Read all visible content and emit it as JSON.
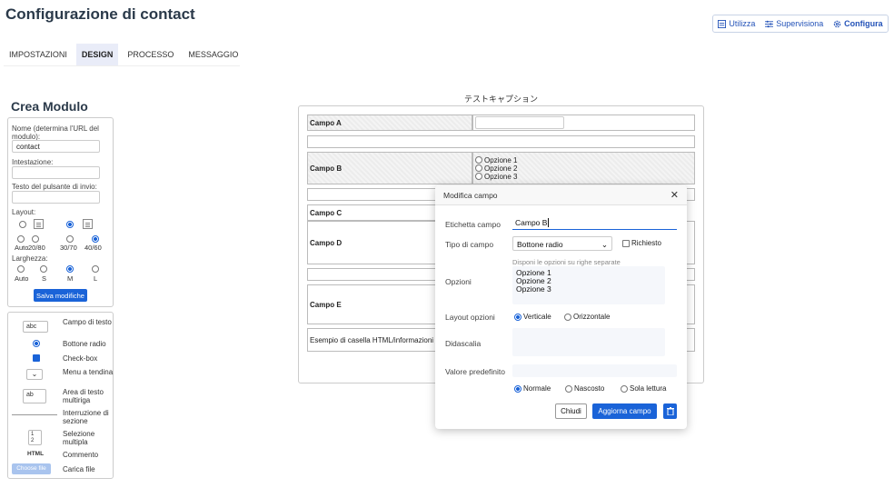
{
  "page_title": "Configurazione di contact",
  "top_actions": [
    {
      "label": "Utilizza",
      "icon": "chart-icon"
    },
    {
      "label": "Supervisiona",
      "icon": "sliders-icon"
    },
    {
      "label": "Configura",
      "icon": "gear-icon"
    }
  ],
  "tabs": [
    "IMPOSTAZIONI",
    "DESIGN",
    "PROCESSO",
    "MESSAGGIO"
  ],
  "active_tab": "DESIGN",
  "sidebar": {
    "heading": "Crea Modulo",
    "name_label": "Nome (determina l'URL del modulo):",
    "name_value": "contact",
    "intestazione_label": "Intestazione:",
    "submit_label": "Testo del pulsante di invio:",
    "layout_label": "Layout:",
    "layout_options": [
      "Auto",
      "20/80",
      "30/70",
      "40/60"
    ],
    "width_label": "Larghezza:",
    "width_options": [
      "Auto",
      "S",
      "M",
      "L"
    ],
    "save_button": "Salva modifiche"
  },
  "tools": [
    {
      "icon": "abc",
      "label": "Campo di testo"
    },
    {
      "icon": "radio",
      "label": "Bottone radio"
    },
    {
      "icon": "checkbox",
      "label": "Check-box"
    },
    {
      "icon": "dropdown",
      "label": "Menu a tendina"
    },
    {
      "icon": "ab",
      "label": "Area di testo multiriga"
    },
    {
      "icon": "line",
      "label": "Interruzione di sezione"
    },
    {
      "icon": "multi",
      "label": "Selezione multipla"
    },
    {
      "icon": "HTML",
      "label": "Commento"
    },
    {
      "icon": "Choose file",
      "label": "Carica file"
    }
  ],
  "form_preview": {
    "caption": "テストキャプション",
    "campo_a": "Campo A",
    "campo_b": "Campo B",
    "campo_b_options": [
      "Opzione 1",
      "Opzione 2",
      "Opzione 3"
    ],
    "campo_c": "Campo C",
    "campo_d": "Campo D",
    "campo_e": "Campo E",
    "html_example": "Esempio di casella HTML/informazioni"
  },
  "modal": {
    "title": "Modifica campo",
    "label_label": "Etichetta campo",
    "label_value": "Campo B",
    "type_label": "Tipo di campo",
    "type_value": "Bottone radio",
    "required_label": "Richiesto",
    "options_hint": "Disponi le opzioni su righe separate",
    "options_label": "Opzioni",
    "options_lines": [
      "Opzione 1",
      "Opzione 2",
      "Opzione 3"
    ],
    "layout_label": "Layout opzioni",
    "layout_vertical": "Verticale",
    "layout_horizontal": "Orizzontale",
    "caption_label": "Didascalia",
    "default_label": "Valore predefinito",
    "visibility_normal": "Normale",
    "visibility_hidden": "Nascosto",
    "visibility_readonly": "Sola lettura",
    "close_button": "Chiudi",
    "update_button": "Aggiorna campo"
  }
}
